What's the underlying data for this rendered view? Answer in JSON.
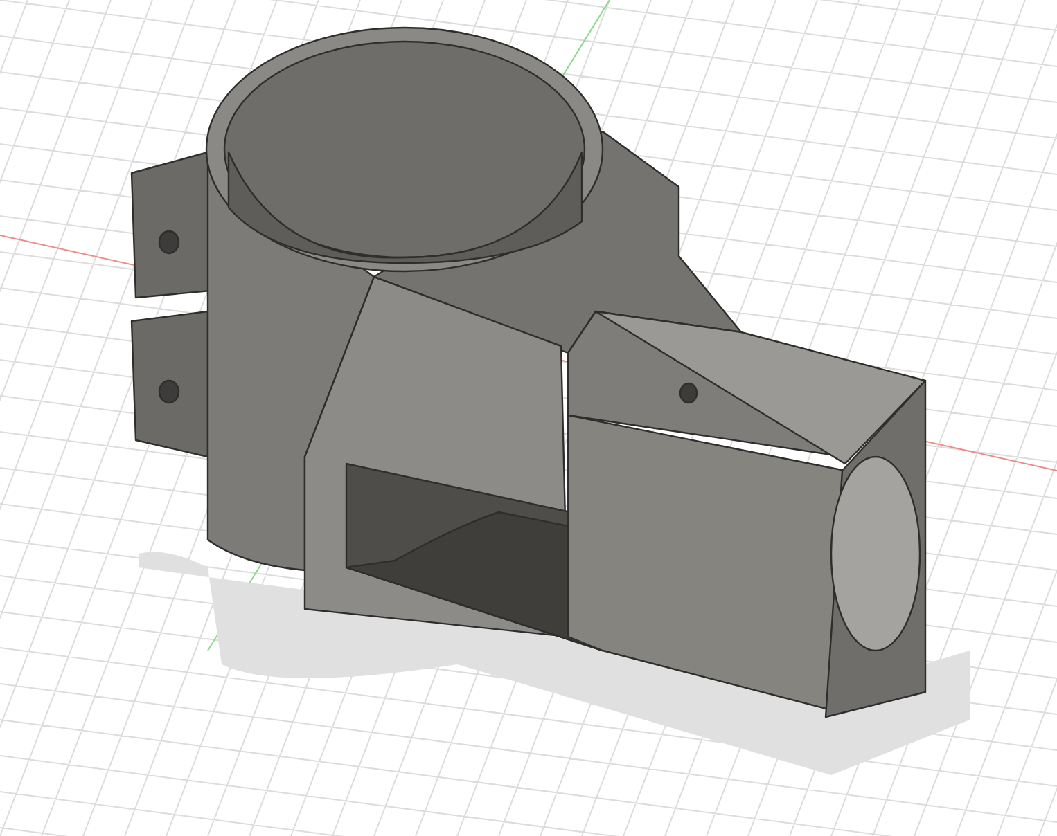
{
  "viewport": {
    "grid": true,
    "axes": true,
    "shadow": true
  }
}
